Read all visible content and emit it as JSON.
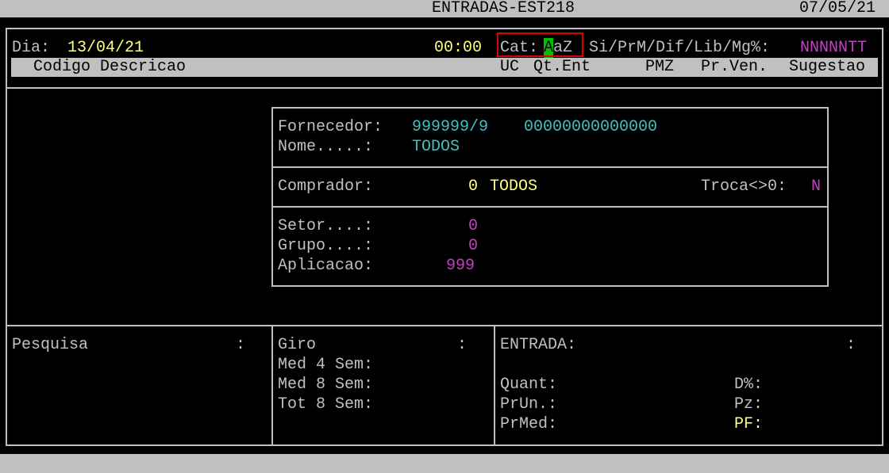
{
  "title_bar": {
    "title": "ENTRADAS-EST218",
    "date": "07/05/21"
  },
  "header": {
    "dia_label": "Dia:",
    "dia_value": "13/04/21",
    "time": "00:00",
    "cat_label": "Cat:",
    "cat_cursor": "A",
    "cat_value": "aZ",
    "flags_label": "Si/PrM/Dif/Lib/Mg%:",
    "flags_value": "NNNNNTT"
  },
  "columns": {
    "left": "Codigo Descricao",
    "uc": "UC",
    "qt_ent": "Qt.Ent",
    "pmz": "PMZ",
    "pr_ven": "Pr.Ven.",
    "sugestao": "Sugestao"
  },
  "filter_panel": {
    "fornecedor_label": "Fornecedor:",
    "fornecedor_code": "999999/9",
    "fornecedor_cnpj": "00000000000000",
    "nome_label": "Nome.....:",
    "nome_value": "TODOS",
    "comprador_label": "Comprador:",
    "comprador_code": "0",
    "comprador_name": "TODOS",
    "troca_label": "Troca<>0:",
    "troca_value": "N",
    "setor_label": "Setor....:",
    "setor_value": "0",
    "grupo_label": "Grupo....:",
    "grupo_value": "0",
    "aplicacao_label": "Aplicacao:",
    "aplicacao_value": "999"
  },
  "bottom": {
    "pesquisa_label": "Pesquisa",
    "pesquisa_colon": ":",
    "giro_label": "Giro",
    "giro_colon": ":",
    "med4_label": "Med 4 Sem:",
    "med8_label": "Med 8 Sem:",
    "tot8_label": "Tot 8 Sem:",
    "entrada_label": "ENTRADA:",
    "entrada_colon": ":",
    "quant_label": "Quant:",
    "prun_label": "PrUn.:",
    "prmed_label": "PrMed:",
    "dpct_label": "D%:",
    "pz_label": "Pz:",
    "pf_label": "PF:"
  },
  "colors": {
    "label_gray": "#c0c0c0",
    "value_yellow": "#ffff80",
    "value_cyan": "#40c0c0",
    "value_magenta": "#c040c0",
    "cursor_green": "#00c000",
    "highlight_red": "#e00000"
  }
}
